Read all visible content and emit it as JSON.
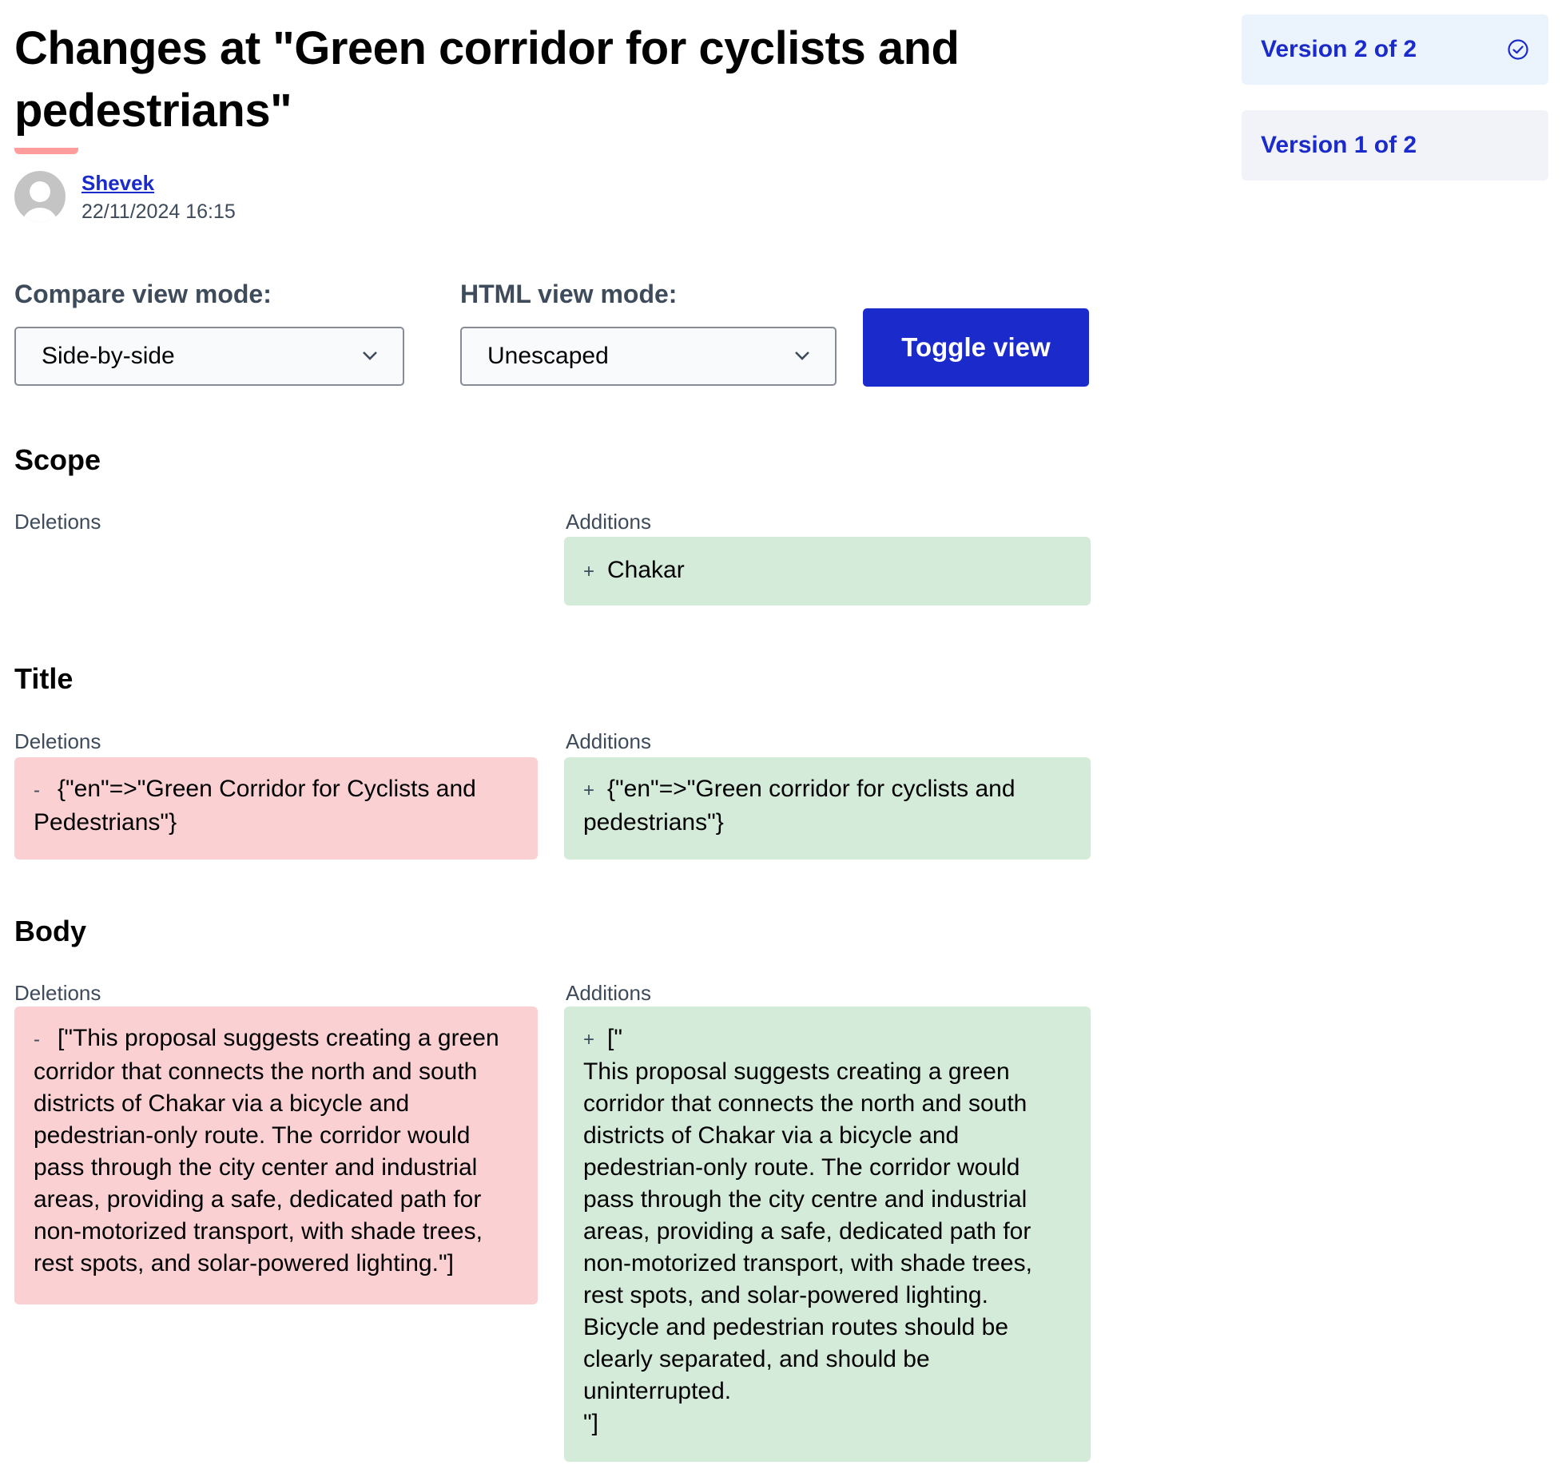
{
  "page": {
    "title": "Changes at \"Green corridor for cyclists and pedestrians\""
  },
  "author": {
    "name": "Shevek",
    "date": "22/11/2024 16:15",
    "avatar_icon": "default-user-avatar-icon"
  },
  "controls": {
    "compare_label": "Compare view mode:",
    "compare_value": "Side-by-side",
    "html_label": "HTML view mode:",
    "html_value": "Unescaped",
    "toggle_label": "Toggle view"
  },
  "colors": {
    "accent": "#1a2acb",
    "deletion_bg": "#fad0d3",
    "addition_bg": "#d4ebda",
    "underline": "#ff9d9d",
    "label_text": "#3e4b5b"
  },
  "sections": [
    {
      "heading": "Scope",
      "deletions_label": "Deletions",
      "additions_label": "Additions",
      "deletions": null,
      "additions": {
        "sign": "+",
        "text": "Chakar"
      }
    },
    {
      "heading": "Title",
      "deletions_label": "Deletions",
      "additions_label": "Additions",
      "deletions": {
        "sign": "-",
        "text": "{\"en\"=>\"Green Corridor for Cyclists and Pedestrians\"}"
      },
      "additions": {
        "sign": "+",
        "text": "{\"en\"=>\"Green corridor for cyclists and pedestrians\"}"
      }
    },
    {
      "heading": "Body",
      "deletions_label": "Deletions",
      "additions_label": "Additions",
      "deletions": {
        "sign": "-",
        "text": "[\"This proposal suggests creating a green corridor that connects the north and south districts of Chakar via a bicycle and pedestrian-only route. The corridor would pass through the city center and industrial areas, providing a safe, dedicated path for non-motorized transport, with shade trees, rest spots, and solar-powered lighting.\"]"
      },
      "additions": {
        "sign": "+",
        "text": "[\"\nThis proposal suggests creating a green corridor that connects the north and south districts of Chakar via a bicycle and pedestrian-only route. The corridor would pass through the city centre and industrial areas, providing a safe, dedicated path for non-motorized transport, with shade trees, rest spots, and solar-powered lighting.\nBicycle and pedestrian routes should be clearly separated, and should be uninterrupted.\n\"]"
      }
    }
  ],
  "versions": [
    {
      "label": "Version 2 of 2",
      "current": true,
      "icon": "check-circle-icon"
    },
    {
      "label": "Version 1 of 2",
      "current": false
    }
  ]
}
